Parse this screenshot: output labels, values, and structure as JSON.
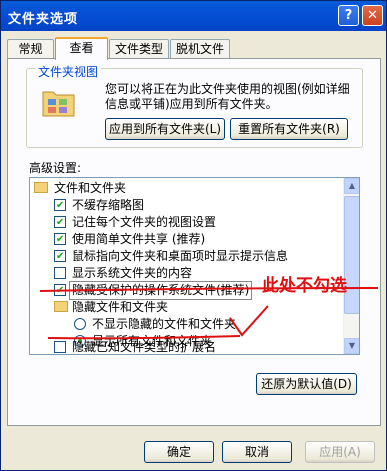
{
  "window": {
    "title": "文件夹选项",
    "help": "?",
    "close": "✕"
  },
  "tabs": [
    {
      "label": "常规",
      "active": false
    },
    {
      "label": "查看",
      "active": true
    },
    {
      "label": "文件类型",
      "active": false
    },
    {
      "label": "脱机文件",
      "active": false
    }
  ],
  "folder_views": {
    "title": "文件夹视图",
    "description": "您可以将正在为此文件夹使用的视图(例如详细信息或平铺)应用到所有文件夹。",
    "apply_all_label": "应用到所有文件夹(L)",
    "reset_all_label": "重置所有文件夹(R)"
  },
  "advanced": {
    "label": "高级设置:",
    "items": [
      {
        "type": "folder",
        "label": "文件和文件夹",
        "level": 0
      },
      {
        "type": "checkbox",
        "label": "不缓存缩略图",
        "checked": true,
        "level": 1
      },
      {
        "type": "checkbox",
        "label": "记住每个文件夹的视图设置",
        "checked": true,
        "level": 1
      },
      {
        "type": "checkbox",
        "label": "使用简单文件共享 (推荐)",
        "checked": true,
        "level": 1
      },
      {
        "type": "checkbox",
        "label": "鼠标指向文件夹和桌面项时显示提示信息",
        "checked": true,
        "level": 1
      },
      {
        "type": "checkbox",
        "label": "显示系统文件夹的内容",
        "checked": false,
        "level": 1
      },
      {
        "type": "checkbox",
        "label": "隐藏受保护的操作系统文件(推荐)",
        "checked": true,
        "level": 1
      },
      {
        "type": "folder",
        "label": "隐藏文件和文件夹",
        "level": 1
      },
      {
        "type": "radio",
        "label": "不显示隐藏的文件和文件夹",
        "checked": false,
        "level": 2
      },
      {
        "type": "radio",
        "label": "显示所有文件和文件夹",
        "checked": true,
        "level": 2
      },
      {
        "type": "checkbox",
        "label": "隐藏已知文件类型的扩展名",
        "checked": false,
        "level": 1
      }
    ]
  },
  "annotation": {
    "text": "此处不勾选",
    "color": "#e01010"
  },
  "buttons": {
    "restore_defaults": "还原为默认值(D)",
    "ok": "确定",
    "cancel": "取消",
    "apply": "应用(A)"
  }
}
